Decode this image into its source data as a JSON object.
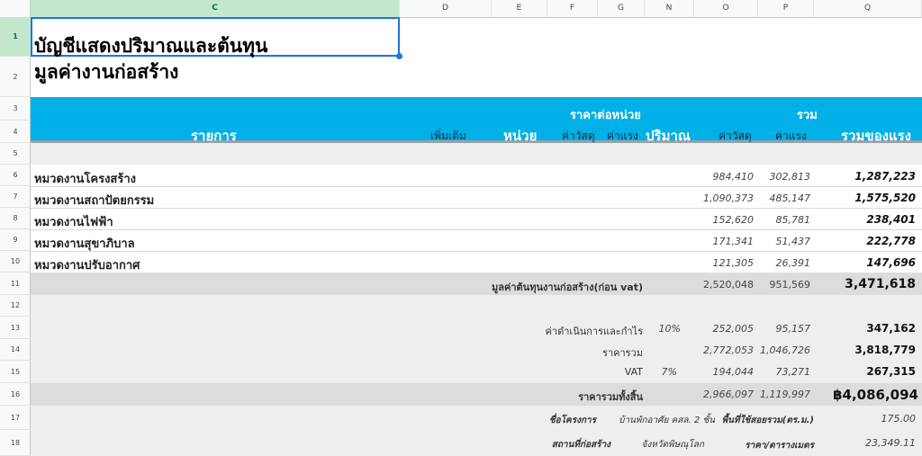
{
  "columns": [
    {
      "letter": "C",
      "selected": true
    },
    {
      "letter": "D"
    },
    {
      "letter": "E"
    },
    {
      "letter": "F"
    },
    {
      "letter": "G"
    },
    {
      "letter": "N"
    },
    {
      "letter": "O"
    },
    {
      "letter": "P"
    },
    {
      "letter": "Q"
    }
  ],
  "rows": [
    "1",
    "2",
    "3",
    "4",
    "5",
    "6",
    "7",
    "8",
    "9",
    "10",
    "11",
    "12",
    "13",
    "14",
    "15",
    "16",
    "17",
    "18"
  ],
  "title": {
    "line1": "บัญชีแสดงปริมาณและต้นทุน",
    "line2": "มูลค่างานก่อสร้าง"
  },
  "header": {
    "unit_price": "ราคาต่อหน่วย",
    "total": "รวม",
    "item": "รายการ",
    "more": "เพิ่มเติม",
    "unit": "หน่วย",
    "material": "ค่าวัสดุ",
    "labor": "ค่าแรง",
    "quantity": "ปริมาณ",
    "material_total": "ค่าวัสดุ",
    "labor_total": "ค่าแรง",
    "grand_total": "รวมของแรง"
  },
  "categories": [
    {
      "name": "หมวดงานโครงสร้าง",
      "material": "984,410",
      "labor": "302,813",
      "total": "1,287,223"
    },
    {
      "name": "หมวดงานสถาปัตยกรรม",
      "material": "1,090,373",
      "labor": "485,147",
      "total": "1,575,520"
    },
    {
      "name": "หมวดงานไฟฟ้า",
      "material": "152,620",
      "labor": "85,781",
      "total": "238,401"
    },
    {
      "name": "หมวดงานสุขาภิบาล",
      "material": "171,341",
      "labor": "51,437",
      "total": "222,778"
    },
    {
      "name": "หมวดงานปรับอากาศ",
      "material": "121,305",
      "labor": "26,391",
      "total": "147,696"
    }
  ],
  "subtotal": {
    "label": "มูลค่าต้นทุนงานก่อสร้าง(ก่อน vat)",
    "material": "2,520,048",
    "labor": "951,569",
    "total": "3,471,618"
  },
  "overhead": {
    "label": "ค่าดำเนินการและกำไร",
    "pct": "10%",
    "material": "252,005",
    "labor": "95,157",
    "total": "347,162"
  },
  "sum": {
    "label": "ราคารวม",
    "material": "2,772,053",
    "labor": "1,046,726",
    "total": "3,818,779"
  },
  "vat": {
    "label": "VAT",
    "pct": "7%",
    "material": "194,044",
    "labor": "73,271",
    "total": "267,315"
  },
  "grand": {
    "label": "ราคารวมทั้งสิ้น",
    "material": "2,966,097",
    "labor": "1,119,997",
    "total": "฿4,086,094"
  },
  "project": {
    "label": "ชื่อโครงการ",
    "value": "บ้านพักอาศัย คสล. 2 ชั้น",
    "area_label": "พื้นที่ใช้สอยรวม(ตร.ม.)",
    "area_value": "175.00"
  },
  "location": {
    "label": "สถานที่ก่อสร้าง",
    "value": "จังหวัดพิษณุโลก",
    "rate_label": "ราคา/ตารางเมตร",
    "rate_value": "23,349.11"
  },
  "colors": {
    "header_band": "#00b0e6",
    "selection": "#1a73e8",
    "selected_header": "#c2e7cc"
  }
}
